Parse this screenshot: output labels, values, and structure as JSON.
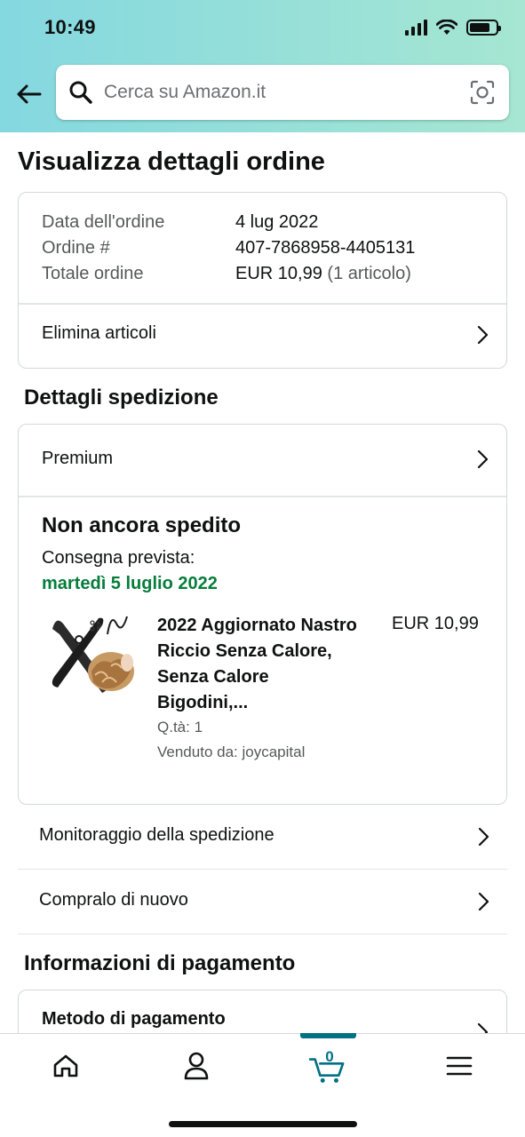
{
  "status_bar": {
    "time": "10:49"
  },
  "search": {
    "placeholder": "Cerca su Amazon.it"
  },
  "page_title": "Visualizza dettagli ordine",
  "order_summary": {
    "rows": [
      {
        "label": "Data dell'ordine",
        "value": "4 lug 2022"
      },
      {
        "label": "Ordine #",
        "value": "407-7868958-4405131"
      },
      {
        "label": "Totale ordine",
        "value": "EUR 10,99",
        "extra": "(1 articolo)"
      }
    ],
    "delete_items_label": "Elimina articoli"
  },
  "shipping": {
    "section_title": "Dettagli spedizione",
    "speed_label": "Premium",
    "status": "Non ancora spedito",
    "delivery_label": "Consegna prevista:",
    "delivery_date": "martedì 5 luglio 2022",
    "item": {
      "name": "2022 Aggiornato Nastro Riccio Senza Calore, Senza Calore Bigodini,...",
      "price": "EUR 10,99",
      "quantity": "Q.tà: 1",
      "seller": "Venduto da: joycapital"
    }
  },
  "actions": [
    {
      "label": "Monitoraggio della spedizione"
    },
    {
      "label": "Compralo di nuovo"
    }
  ],
  "payment": {
    "section_title": "Informazioni di pagamento",
    "method_label": "Metodo di pagamento"
  },
  "bottom_nav": {
    "items": [
      "home-icon",
      "account-icon",
      "cart-icon",
      "menu-icon"
    ],
    "active": "cart-icon",
    "cart_count": "0"
  },
  "colors": {
    "accent": "#007185",
    "delivery_green": "#067d3b",
    "header_start": "#84d8e0",
    "header_end": "#a6e6d2"
  }
}
